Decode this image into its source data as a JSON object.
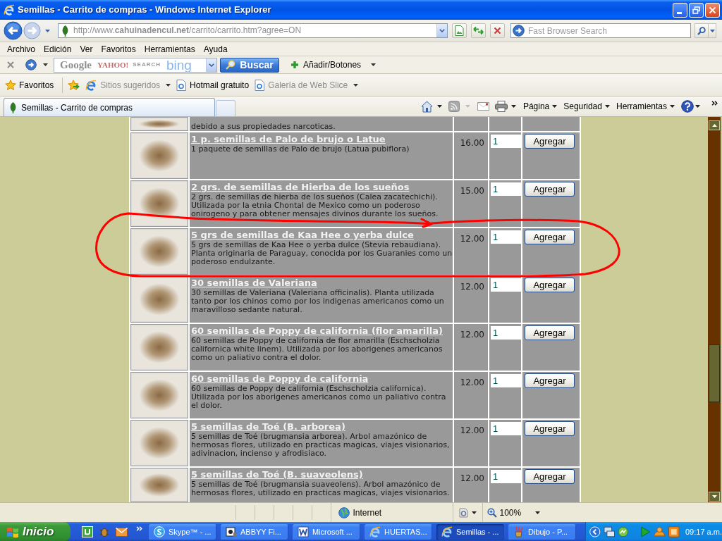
{
  "window": {
    "title": "Semillas - Carrito de compras - Windows Internet Explorer"
  },
  "address_bar": {
    "url": "http://www.**cahuinadencul.net**/carrito/carrito.htm?agree=ON"
  },
  "search_box": {
    "placeholder": "Fast Browser Search"
  },
  "menu_bar": [
    "Archivo",
    "Edición",
    "Ver",
    "Favoritos",
    "Herramientas",
    "Ayuda"
  ],
  "search_toolbar": {
    "engines": [
      {
        "label": "Google",
        "color": "#8f8f8f"
      },
      {
        "label": "YAHOO!",
        "color": "#c96a6a"
      },
      {
        "label": "SEARCH",
        "color": "#9a9a9a"
      },
      {
        "label": "bing",
        "color": "#89b6e8"
      }
    ],
    "button": "Buscar",
    "add_buttons": "Añadir/Botones"
  },
  "favorites_bar": {
    "label": "Favoritos",
    "items": [
      {
        "label": "Sitios sugeridos",
        "kind": "menu",
        "disabled": true
      },
      {
        "label": "Hotmail gratuito",
        "kind": "link",
        "disabled": false
      },
      {
        "label": "Galería de Web Slice",
        "kind": "menu",
        "disabled": true
      }
    ]
  },
  "tabs": [
    {
      "label": "Semillas - Carrito de compras",
      "selected": true
    }
  ],
  "command_bar": [
    "Página",
    "Seguridad",
    "Herramientas"
  ],
  "products": [
    {
      "description": "debido a sus propiedades narcoticas."
    },
    {
      "title": "1 p. semillas de Palo de brujo o Latue",
      "description": "1 paquete de semillas de Palo de brujo (Latua pubiflora)",
      "price": "16.00",
      "quantity": "1",
      "button": "Agregar"
    },
    {
      "title": "2 grs. de semillas de Hierba de los sueños",
      "description": "2 grs. de semillas de hierba de los sueños (Calea zacatechichi). Utilizada por la etnia Chontal de Mexico como un poderoso onirogeno y para obtener mensajes divinos durante los sueños.",
      "price": "15.00",
      "quantity": "1",
      "button": "Agregar"
    },
    {
      "title": "5 grs de semillas de Kaa Hee o yerba dulce",
      "description": "5 grs de semillas de Kaa Hee o yerba dulce (Stevia rebaudiana). Planta originaria de Paraguay, conocida por los Guaranies como un poderoso endulzante.",
      "price": "12.00",
      "quantity": "1",
      "button": "Agregar"
    },
    {
      "title": "30 semillas de Valeriana",
      "description": "30 semillas de Valeriana (Valeriana officinalis). Planta utilizada tanto por los chinos como por los indigenas americanos como un maravilloso sedante natural.",
      "price": "12.00",
      "quantity": "1",
      "button": "Agregar"
    },
    {
      "title": "60 semillas de Poppy de california (flor amarilla)",
      "description": "60 semillas de Poppy de california de flor amarilla (Eschscholzia californica white linem). Utilizada por los aborigenes americanos como un paliativo contra el dolor.",
      "price": "12.00",
      "quantity": "1",
      "button": "Agregar"
    },
    {
      "title": "60 semillas de Poppy de california",
      "description": "60 semillas de Poppy de california (Eschscholzia californica). Utilizada por los aborigenes americanos como un paliativo contra el dolor.",
      "price": "12.00",
      "quantity": "1",
      "button": "Agregar"
    },
    {
      "title": "5 semillas de Toé (B. arborea)",
      "description": "5 semillas de Toé (brugmansia arborea). Arbol amazónico de hermosas flores, utilizado en practicas magicas, viajes visionarios, adivinacion, incienso y afrodisiaco.",
      "price": "12.00",
      "quantity": "1",
      "button": "Agregar"
    },
    {
      "title": "5 semillas de Toé (B. suaveolens)",
      "description": "5 semillas de Toé (brugmansia suaveolens). Arbol amazónico de hermosas flores, utilizado en practicas magicas, viajes visionarios.",
      "price": "12.00",
      "quantity": "1",
      "button": "Agregar"
    }
  ],
  "status_bar": {
    "zone": "Internet",
    "zoom": "100%"
  },
  "taskbar": {
    "start": "Inicio",
    "tasks": [
      {
        "label": "Skype™ - ...",
        "kind": "chat",
        "selected": false
      },
      {
        "label": "ABBYY Fi...",
        "kind": "scanner",
        "selected": false
      },
      {
        "label": "Microsoft ...",
        "kind": "document",
        "selected": false
      },
      {
        "label": "HUERTAS...",
        "kind": "browser",
        "selected": false
      },
      {
        "label": "Semillas - ...",
        "kind": "browser",
        "selected": true
      },
      {
        "label": "Dibujo - P...",
        "kind": "paint",
        "selected": false
      }
    ],
    "clock": "09:17 a.m."
  }
}
